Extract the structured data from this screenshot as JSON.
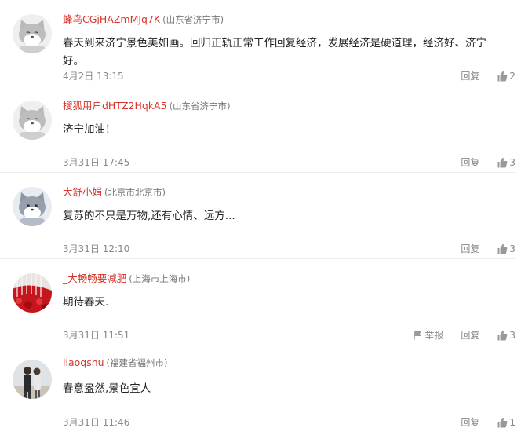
{
  "comments": [
    {
      "username": "蜂鸟CGjHAZmMJq7K",
      "location": "(山东省济宁市)",
      "text": "春天到来济宁景色美如画。回归正轨正常工作回复经济，发展经济是硬道理，经济好、济宁好。",
      "time": "4月2日 13:15",
      "reply_label": "回复",
      "likes": "2"
    },
    {
      "username": "搜狐用户dHTZ2HqkA5",
      "location": "(山东省济宁市)",
      "text": "济宁加油！",
      "time": "3月31日 17:45",
      "reply_label": "回复",
      "likes": "3"
    },
    {
      "username": "大舒小娟",
      "location": "(北京市北京市)",
      "text": "复苏的不只是万物,还有心情、远方...",
      "time": "3月31日 12:10",
      "reply_label": "回复",
      "likes": "3"
    },
    {
      "username": "_大畅畅要减肥",
      "location": "(上海市上海市)",
      "text": "期待春天.",
      "time": "3月31日 11:51",
      "report_label": "举报",
      "reply_label": "回复",
      "likes": "3"
    },
    {
      "username": "liaoqshu",
      "location": "(福建省福州市)",
      "text": "春意盎然,景色宜人",
      "time": "3月31日 11:46",
      "reply_label": "回复",
      "likes": "1"
    }
  ],
  "colors": {
    "username": "#d7342b",
    "muted": "#888888",
    "divider": "#ececec"
  },
  "icons": {
    "like": "thumbs-up-icon",
    "report": "flag-icon",
    "avatar_default": "cat-face-avatar"
  }
}
